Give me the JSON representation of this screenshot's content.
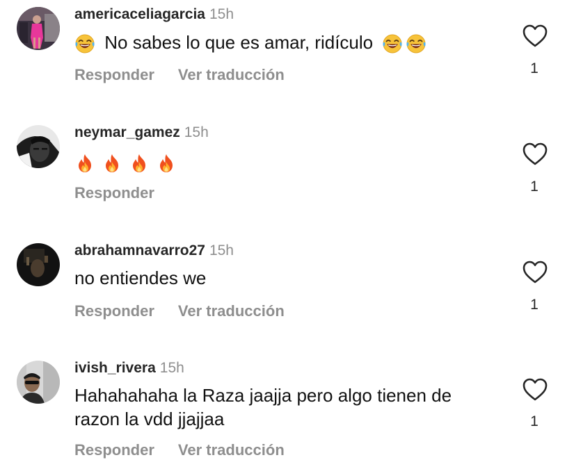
{
  "colors": {
    "username": "#262626",
    "meta": "#8e8e8e",
    "text": "#111111"
  },
  "comments": [
    {
      "username": "americaceliagarcia",
      "time": "15h",
      "text": "No sabes lo que es amar, ridículo",
      "reply_label": "Responder",
      "translate_label": "Ver traducción",
      "likes": "1",
      "lead_emoji": "face-with-tears-of-joy",
      "trail_emoji": "face-with-tears-of-joy x2"
    },
    {
      "username": "neymar_gamez",
      "time": "15h",
      "emoji": "fire x4",
      "reply_label": "Responder",
      "likes": "1"
    },
    {
      "username": "abrahamnavarro27",
      "time": "15h",
      "text": "no entiendes we",
      "reply_label": "Responder",
      "translate_label": "Ver traducción",
      "likes": "1"
    },
    {
      "username": "ivish_rivera",
      "time": "15h",
      "text_line1": "Hahahahaha la Raza jaajja pero algo tienen de",
      "text_line2": "razon la vdd jjajjaa",
      "reply_label": "Responder",
      "translate_label": "Ver traducción",
      "likes": "1"
    }
  ]
}
